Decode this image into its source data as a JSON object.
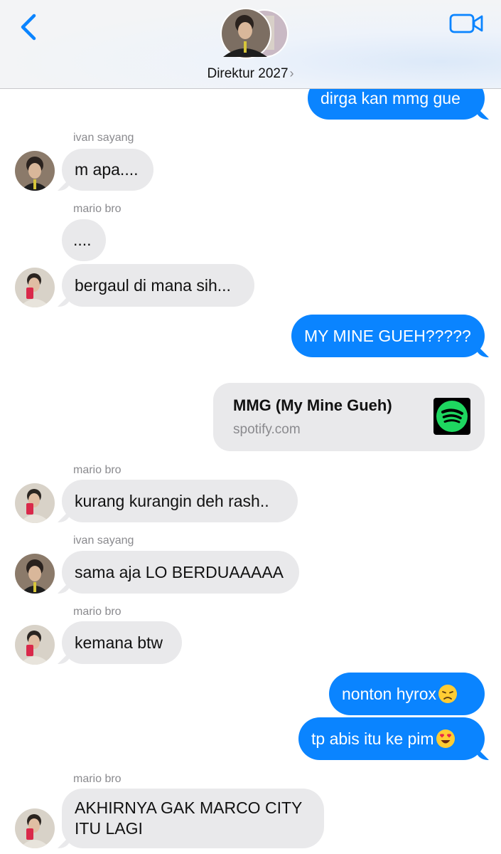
{
  "header": {
    "title": "Direktur 2027",
    "chevron": "›",
    "back_icon": "chevron-left-icon",
    "video_icon": "video-camera-icon",
    "accent": "#0a84ff"
  },
  "messages": [
    {
      "direction": "out",
      "text": "dirga kan mmg gue"
    },
    {
      "direction": "in",
      "sender": "ivan sayang",
      "text": "m apa...."
    },
    {
      "direction": "in",
      "sender": "mario bro",
      "text": "...."
    },
    {
      "direction": "in",
      "text": "bergaul di mana sih..."
    },
    {
      "direction": "out",
      "text": "MY MINE GUEH?????"
    },
    {
      "direction": "out",
      "type": "link",
      "title": "MMG (My Mine Gueh)",
      "domain": "spotify.com",
      "icon": "spotify-icon"
    },
    {
      "direction": "in",
      "sender": "mario bro",
      "text": "kurang kurangin deh rash.."
    },
    {
      "direction": "in",
      "sender": "ivan sayang",
      "text": "sama aja LO BERDUAAAAA"
    },
    {
      "direction": "in",
      "sender": "mario bro",
      "text": "kemana btw"
    },
    {
      "direction": "out",
      "text": "nonton hyrox",
      "emoji": "disappointed-face"
    },
    {
      "direction": "out",
      "text": "tp abis itu ke pim",
      "emoji": "heart-eyes-face"
    },
    {
      "direction": "in",
      "sender": "mario bro",
      "text": "AKHIRNYA GAK MARCO CITY ITU LAGI"
    }
  ],
  "colors": {
    "outgoing_bubble": "#0a84ff",
    "incoming_bubble": "#e9e9eb",
    "spotify_green": "#1ed760"
  }
}
